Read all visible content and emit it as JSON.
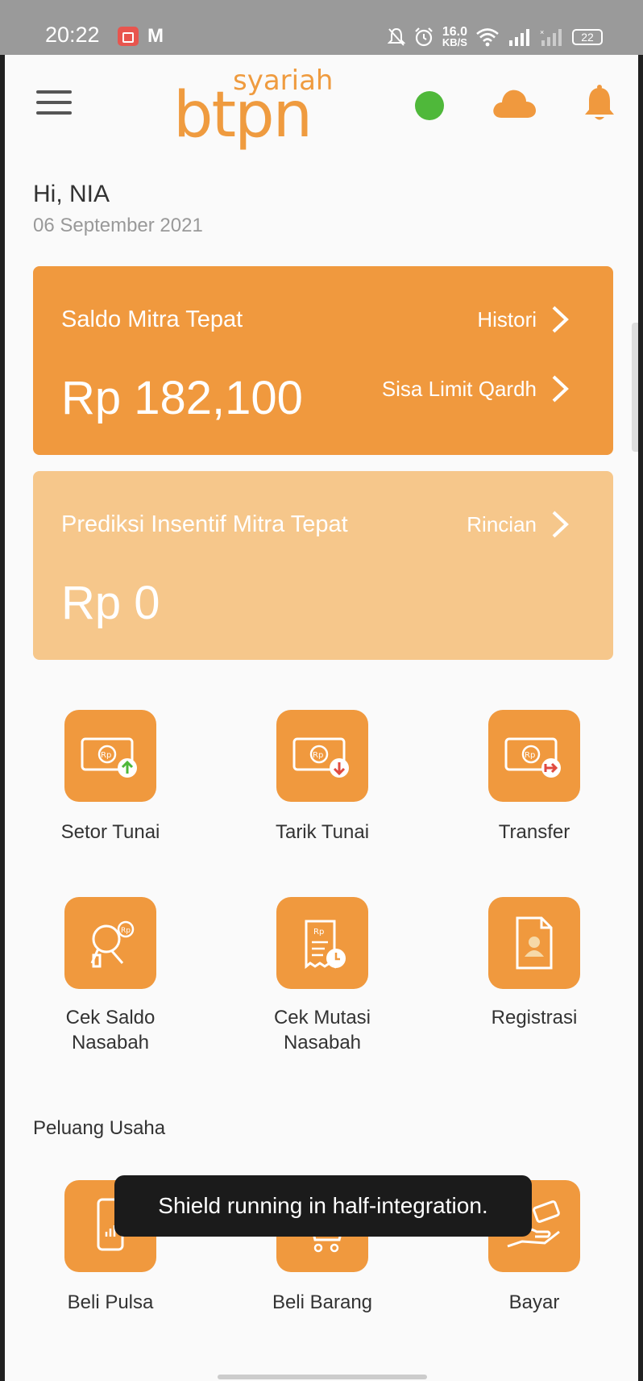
{
  "status_bar": {
    "time": "20:22",
    "net_speed_value": "16.0",
    "net_speed_unit": "KB/S",
    "battery": "22",
    "icons": [
      "screen-record-icon",
      "gmail-icon",
      "mute-icon",
      "alarm-icon",
      "wifi-icon",
      "signal-icon",
      "signal-off-icon",
      "battery-icon"
    ]
  },
  "header": {
    "logo_top": "syariah",
    "logo_main": "btpn",
    "status_color": "#4fb83a",
    "accent_color": "#f0993e"
  },
  "greeting": {
    "hello": "Hi, NIA",
    "date": "06 September 2021"
  },
  "saldo_card": {
    "title": "Saldo Mitra Tepat",
    "amount": "Rp 182,100",
    "link_histori": "Histori",
    "link_limit": "Sisa Limit Qardh"
  },
  "insentif_card": {
    "title": "Prediksi Insentif Mitra Tepat",
    "amount": "Rp 0",
    "link_rincian": "Rincian"
  },
  "menu": {
    "setor_tunai": "Setor Tunai",
    "tarik_tunai": "Tarik Tunai",
    "transfer": "Transfer",
    "cek_saldo_1": "Cek Saldo",
    "cek_saldo_2": "Nasabah",
    "cek_mutasi_1": "Cek Mutasi",
    "cek_mutasi_2": "Nasabah",
    "registrasi": "Registrasi"
  },
  "peluang": {
    "title": "Peluang Usaha",
    "beli_pulsa": "Beli Pulsa",
    "beli_barang": "Beli Barang",
    "bayar": "Bayar"
  },
  "toast": "Shield running in half-integration."
}
